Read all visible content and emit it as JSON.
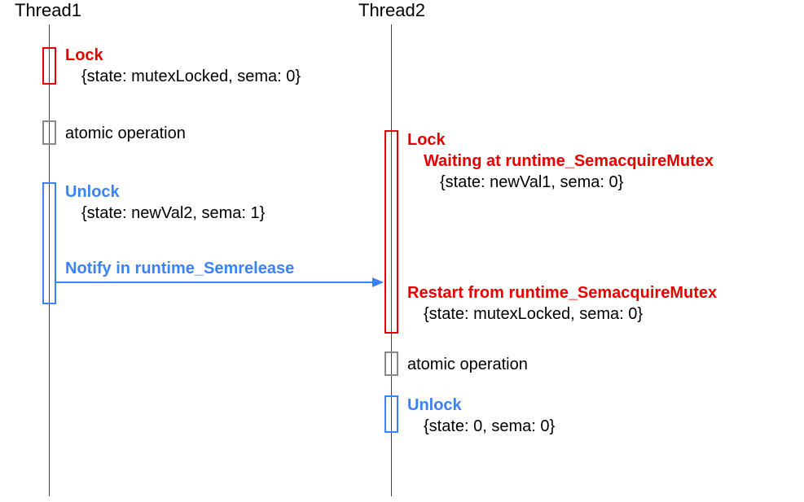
{
  "thread1": {
    "title": "Thread1",
    "lock": {
      "label": "Lock",
      "state": "{state: mutexLocked, sema: 0}"
    },
    "atomic": "atomic operation",
    "unlock": {
      "label": "Unlock",
      "state": "{state: newVal2, sema: 1}"
    },
    "notify": "Notify in runtime_Semrelease"
  },
  "thread2": {
    "title": "Thread2",
    "lock": {
      "label": "Lock",
      "waiting": "Waiting at runtime_SemacquireMutex",
      "waiting_state": "{state: newVal1, sema: 0}",
      "restart": "Restart from runtime_SemacquireMutex",
      "restart_state": "{state: mutexLocked, sema: 0}"
    },
    "atomic": "atomic operation",
    "unlock": {
      "label": "Unlock",
      "state": "{state: 0, sema: 0}"
    }
  },
  "chart_data": {
    "type": "sequence-diagram",
    "threads": [
      "Thread1",
      "Thread2"
    ],
    "events": [
      {
        "thread": "Thread1",
        "action": "Lock",
        "state": "mutexLocked",
        "sema": 0
      },
      {
        "thread": "Thread1",
        "action": "atomic operation"
      },
      {
        "thread": "Thread2",
        "action": "Lock",
        "note": "Waiting at runtime_SemacquireMutex",
        "state": "newVal1",
        "sema": 0
      },
      {
        "thread": "Thread1",
        "action": "Unlock",
        "state": "newVal2",
        "sema": 1
      },
      {
        "thread": "Thread1",
        "action": "Notify in runtime_Semrelease",
        "target": "Thread2"
      },
      {
        "thread": "Thread2",
        "action": "Restart from runtime_SemacquireMutex",
        "state": "mutexLocked",
        "sema": 0
      },
      {
        "thread": "Thread2",
        "action": "atomic operation"
      },
      {
        "thread": "Thread2",
        "action": "Unlock",
        "state": 0,
        "sema": 0
      }
    ]
  }
}
